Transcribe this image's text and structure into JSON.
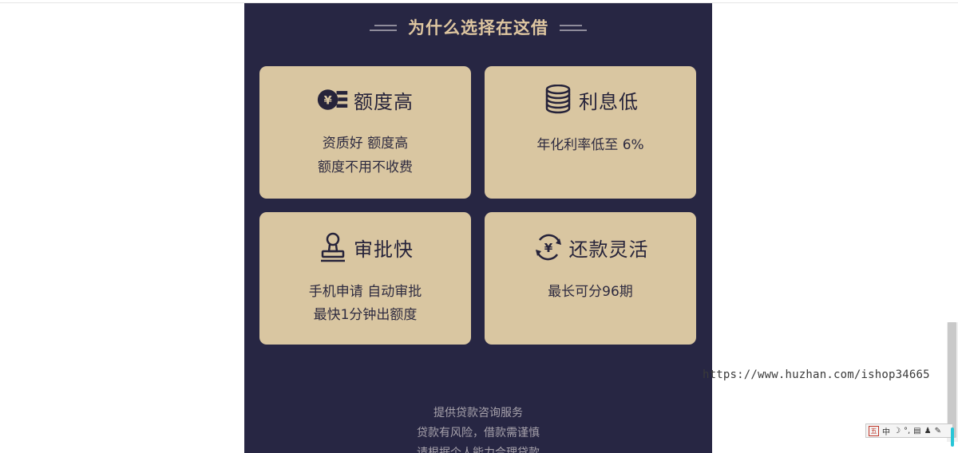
{
  "page": {
    "heading": "为什么选择在这借"
  },
  "cards": [
    {
      "title": "额度高",
      "icon": "yen-coin-icon",
      "lines": [
        "资质好   额度高",
        "额度不用不收费"
      ]
    },
    {
      "title": "利息低",
      "icon": "coin-stack-icon",
      "lines": [
        "年化利率低至 6%"
      ]
    },
    {
      "title": "审批快",
      "icon": "stamp-icon",
      "lines": [
        "手机申请 自动审批",
        "最快1分钟出额度"
      ]
    },
    {
      "title": "还款灵活",
      "icon": "yen-cycle-icon",
      "lines": [
        "最长可分96期"
      ]
    }
  ],
  "footer": {
    "lines": [
      "提供贷款咨询服务",
      "贷款有风险，借款需谨慎",
      "请根据个人能力合理贷款"
    ]
  },
  "watermark": "https://www.huzhan.com/ishop34665",
  "ime": {
    "mode": "中",
    "logo": "五"
  },
  "colors": {
    "panel": "#272643",
    "card": "#d9c6a1",
    "heading": "#dec6a0",
    "text": "#2e2b40"
  }
}
